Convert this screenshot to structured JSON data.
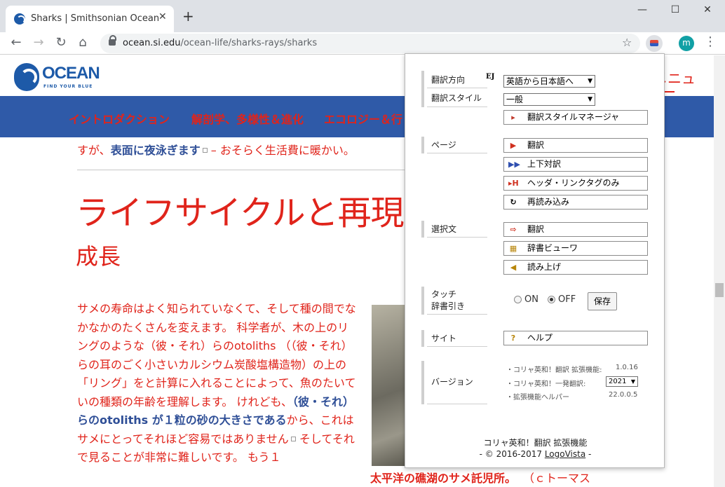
{
  "browser": {
    "tab_title": "Sharks | Smithsonian Ocean",
    "tab_close": "✕",
    "new_tab": "+",
    "url_host": "ocean.si.edu",
    "url_path": "/ocean-life/sharks-rays/sharks",
    "avatar_letter": "m",
    "icons": [
      "back-icon",
      "forward-icon",
      "reload-icon",
      "home-icon",
      "lock-icon",
      "star-icon",
      "extension-icon",
      "menu-icon"
    ]
  },
  "site": {
    "logo_word": "OCEAN",
    "logo_tagline": "FIND YOUR BLUE",
    "menu_label": "メニュ",
    "nav": [
      "イントロダクション",
      "解剖学、多様性＆進化",
      "エコロジー＆行"
    ],
    "top_line_pre": "すが、",
    "top_line_bold": "表面に夜泳ぎます",
    "top_line_post": " – おそらく生活費に暖かい。",
    "heading": "ライフサイクルと再現",
    "subheading": "成長",
    "paragraph": {
      "p1": "サメの寿命はよく知られていなくて、そして種の間でなかなかのたくさんを変えます。 科学者が、木の上のリングのような（彼・それ）らのotoliths （（彼・それ）らの耳のごく小さいカルシウム炭酸塩構造物）の上の「リング」をと計算に入れることによって、魚のたいていの種類の年齢を理解します。 けれども、",
      "p1_bold": "（彼・それ）らのotoliths が１粒の砂の大きさである",
      "p2": "から、これはサメにとってそれほど容易ではありません",
      "p3": " そしてそれで見ることが非常に難しいです。 もう１"
    },
    "caption": "太平洋の礁湖のサメ託児所。",
    "caption_credit": "（ｃトーマス"
  },
  "popup": {
    "sections": {
      "direction": "翻訳方向",
      "style": "翻訳スタイル",
      "page": "ページ",
      "selection": "選択文",
      "touch_line1": "タッチ",
      "touch_line2": "辞書引き",
      "site": "サイト",
      "version": "バージョン"
    },
    "ej_badge": "EJ",
    "direction_value": "英語から日本語へ",
    "style_value": "一般",
    "buttons": {
      "style_manager": "翻訳スタイルマネージャ",
      "translate_page": "翻訳",
      "parallel": "上下対訳",
      "header_link": "ヘッダ・リンクタグのみ",
      "reload": "再読み込み",
      "translate_selection": "翻訳",
      "dictionary": "辞書ビューワ",
      "read_aloud": "読み上げ",
      "help": "ヘルプ"
    },
    "touch": {
      "on_label": "ON",
      "off_label": "OFF",
      "selected": "OFF",
      "save": "保存"
    },
    "version": {
      "row1_label": "・コリャ英和！翻訳 拡張機能:",
      "row1_value": "1.0.16",
      "row2_label": "・コリャ英和！一発翻訳:",
      "row2_value": "2021",
      "row3_label": "・拡張機能ヘルパー",
      "row3_value": "22.0.0.5"
    },
    "footer_title": "コリャ英和！翻訳 拡張機能",
    "footer_copy_pre": "- © 2016-2017 ",
    "footer_link": "LogoVista",
    "footer_copy_post": " -",
    "colors": {
      "accent_red": "#e0241b",
      "nav_blue": "#2f5aa8"
    }
  }
}
